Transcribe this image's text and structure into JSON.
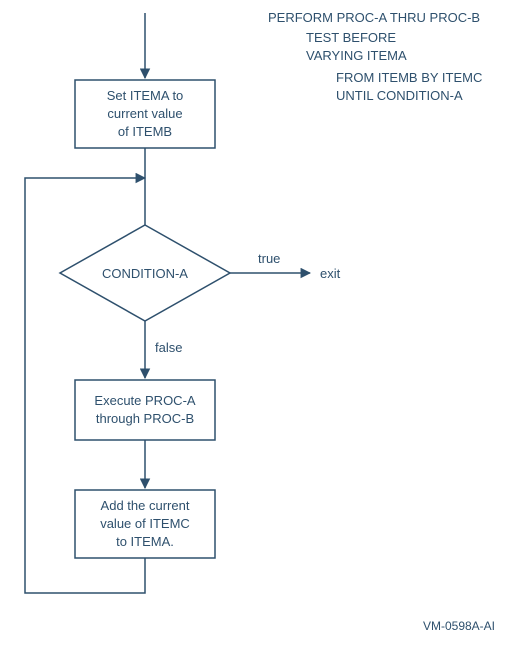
{
  "code": {
    "l1": "PERFORM PROC-A THRU PROC-B",
    "l2": "TEST BEFORE",
    "l3": "VARYING ITEMA",
    "l4": "FROM ITEMB BY ITEMC",
    "l5": "UNTIL CONDITION-A"
  },
  "box_set": {
    "l1": "Set ITEMA to",
    "l2": "current value",
    "l3": "of ITEMB"
  },
  "decision": {
    "label": "CONDITION-A",
    "true_branch": "true",
    "false_branch": "false",
    "exit_label": "exit"
  },
  "box_exec": {
    "l1": "Execute PROC-A",
    "l2": "through PROC-B"
  },
  "box_add": {
    "l1": "Add the current",
    "l2": "value of ITEMC",
    "l3": "to ITEMA."
  },
  "figure_id": "VM-0598A-AI"
}
